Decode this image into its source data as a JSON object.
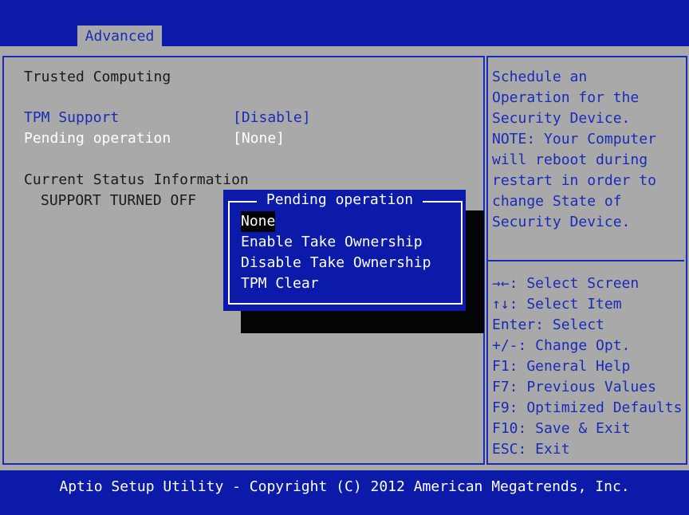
{
  "tabs": {
    "advanced": "Advanced"
  },
  "left": {
    "section_title": "Trusted Computing",
    "tpm_support": {
      "label": "TPM Support",
      "value": "[Disable]"
    },
    "pending_operation": {
      "label": "Pending operation",
      "value": "[None]"
    },
    "status_title": "Current Status Information",
    "status_value": "SUPPORT TURNED OFF"
  },
  "popup": {
    "title": "Pending operation",
    "options": [
      "None",
      "Enable Take Ownership",
      "Disable Take Ownership",
      "TPM Clear"
    ],
    "selected": "None"
  },
  "help": {
    "description": [
      "Schedule an",
      "Operation for the",
      "Security Device.",
      "NOTE: Your Computer",
      "will reboot during",
      "restart in order to",
      "change State of",
      "Security Device."
    ],
    "keys": [
      "→←: Select Screen",
      "↑↓: Select Item",
      "Enter: Select",
      "+/-: Change Opt.",
      "F1: General Help",
      "F7: Previous Values",
      "F9: Optimized Defaults",
      "F10: Save & Exit",
      "ESC: Exit"
    ]
  },
  "footer": "Aptio Setup Utility - Copyright (C) 2012 American Megatrends, Inc.",
  "colors": {
    "bios_blue": "#0b1aa8",
    "panel_gray": "#a9a9aa",
    "accent_blue": "#1a2bb8"
  }
}
